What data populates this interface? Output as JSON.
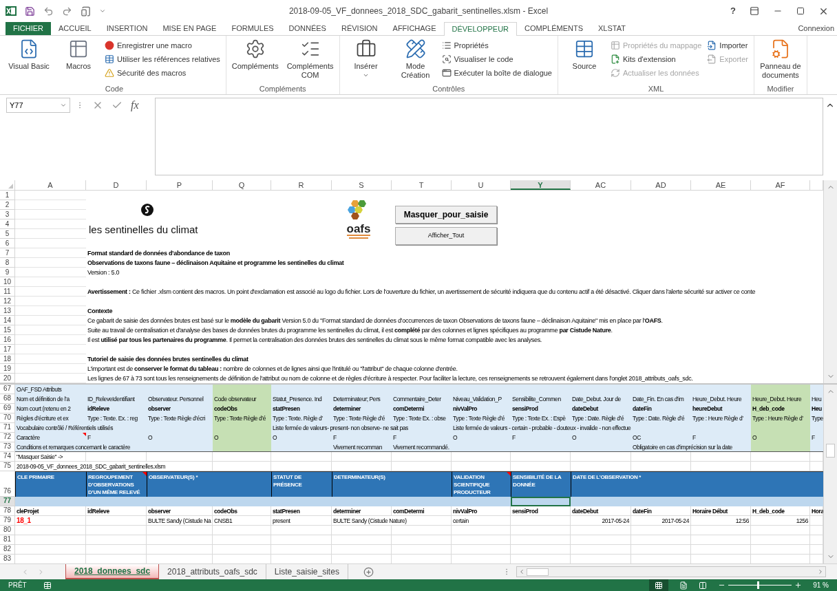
{
  "window": {
    "title": "2018-09-05_VF_donnees_2018_SDC_gabarit_sentinelles.xlsm - Excel",
    "help": "?",
    "account": "Connexion"
  },
  "ribbon_tabs": [
    {
      "label": "FICHIER",
      "kind": "file",
      "selected": false
    },
    {
      "label": "ACCUEIL",
      "kind": "tab",
      "selected": false
    },
    {
      "label": "INSERTION",
      "kind": "tab",
      "selected": false
    },
    {
      "label": "MISE EN PAGE",
      "kind": "tab",
      "selected": false
    },
    {
      "label": "FORMULES",
      "kind": "tab",
      "selected": false
    },
    {
      "label": "DONNÉES",
      "kind": "tab",
      "selected": false
    },
    {
      "label": "RÉVISION",
      "kind": "tab",
      "selected": false
    },
    {
      "label": "AFFICHAGE",
      "kind": "tab",
      "selected": false
    },
    {
      "label": "DÉVELOPPEUR",
      "kind": "tab",
      "selected": true
    },
    {
      "label": "COMPLÉMENTS",
      "kind": "tab",
      "selected": false
    },
    {
      "label": "XLSTAT",
      "kind": "tab",
      "selected": false
    }
  ],
  "ribbon_groups": [
    {
      "label": "Code",
      "items": [
        {
          "label": "Visual Basic",
          "kind": "large",
          "disabled": false,
          "menu": false
        },
        {
          "label": "Macros",
          "kind": "large",
          "disabled": false,
          "menu": false
        },
        {
          "label": "Enregistrer une macro",
          "kind": "small",
          "disabled": false,
          "menu": false
        },
        {
          "label": "Utiliser les références relatives",
          "kind": "small",
          "disabled": false,
          "menu": false
        },
        {
          "label": "Sécurité des macros",
          "kind": "small",
          "disabled": false,
          "menu": false
        }
      ]
    },
    {
      "label": "Compléments",
      "items": [
        {
          "label": "Compléments",
          "kind": "large",
          "disabled": false,
          "menu": false
        },
        {
          "label": "Compléments COM",
          "kind": "large",
          "disabled": false,
          "menu": false
        }
      ]
    },
    {
      "label": "Contrôles",
      "items": [
        {
          "label": "Insérer",
          "kind": "large",
          "disabled": false,
          "menu": true
        },
        {
          "label": "Mode Création",
          "kind": "large",
          "disabled": false,
          "menu": false
        },
        {
          "label": "Propriétés",
          "kind": "small",
          "disabled": false,
          "menu": false
        },
        {
          "label": "Visualiser le code",
          "kind": "small",
          "disabled": false,
          "menu": false
        },
        {
          "label": "Exécuter la boîte de dialogue",
          "kind": "small",
          "disabled": false,
          "menu": false
        }
      ]
    },
    {
      "label": "XML",
      "items": [
        {
          "label": "Source",
          "kind": "large",
          "disabled": false,
          "menu": false
        },
        {
          "label": "Propriétés du mappage",
          "kind": "small",
          "disabled": true,
          "menu": false
        },
        {
          "label": "Kits d'extension",
          "kind": "small",
          "disabled": false,
          "menu": false
        },
        {
          "label": "Actualiser les données",
          "kind": "small",
          "disabled": true,
          "menu": false
        },
        {
          "label": "Importer",
          "kind": "small",
          "disabled": false,
          "menu": false
        },
        {
          "label": "Exporter",
          "kind": "small",
          "disabled": true,
          "menu": false
        }
      ]
    },
    {
      "label": "Modifier",
      "items": [
        {
          "label": "Panneau de documents",
          "kind": "large",
          "disabled": false,
          "menu": false
        }
      ]
    }
  ],
  "formula_bar": {
    "name_box": "Y77",
    "function_button": "fx"
  },
  "columns": [
    {
      "label": "A",
      "selected": false,
      "highlighted": false
    },
    {
      "label": "D",
      "selected": false,
      "highlighted": false
    },
    {
      "label": "P",
      "selected": false,
      "highlighted": false
    },
    {
      "label": "Q",
      "selected": false,
      "highlighted": true
    },
    {
      "label": "R",
      "selected": false,
      "highlighted": false
    },
    {
      "label": "S",
      "selected": false,
      "highlighted": false
    },
    {
      "label": "T",
      "selected": false,
      "highlighted": false
    },
    {
      "label": "U",
      "selected": false,
      "highlighted": false
    },
    {
      "label": "Y",
      "selected": true,
      "highlighted": false
    },
    {
      "label": "AC",
      "selected": false,
      "highlighted": false
    },
    {
      "label": "AD",
      "selected": false,
      "highlighted": false
    },
    {
      "label": "AE",
      "selected": false,
      "highlighted": false
    },
    {
      "label": "AF",
      "selected": false,
      "highlighted": true
    },
    {
      "selected": false,
      "highlighted": false
    }
  ],
  "logos": {
    "sentinelles": "les sentinelles du climat",
    "oafs": "oafs"
  },
  "sheet_buttons": [
    "Masquer_pour_saisie",
    "Afficher_Tout"
  ],
  "top_rows": [
    {
      "number": "1",
      "kind": "blank"
    },
    {
      "number": "2",
      "kind": "blank"
    },
    {
      "number": "3",
      "kind": "blank"
    },
    {
      "number": "4",
      "kind": "blank"
    },
    {
      "number": "5",
      "kind": "blank"
    },
    {
      "number": "6",
      "kind": "blank"
    },
    {
      "number": "7",
      "kind": "heading",
      "text": "Format standard de données d’abondance de taxon"
    },
    {
      "number": "8",
      "kind": "heading",
      "text": "Observations de taxons faune – déclinaison Aquitaine et programme les sentinelles du climat"
    },
    {
      "number": "9",
      "kind": "text",
      "text": "Version : 5.0"
    },
    {
      "number": "10",
      "kind": "blank"
    },
    {
      "number": "11",
      "kind": "text",
      "text": "**Avertissement :** Ce fichier .xlsm contient des macros. Un point d'exclamation est associé au logo du fichier. Lors de l'ouverture du fichier, un avertissement de sécurité indiquera que du contenu actif a été désactivé. Cliquer dans l'alerte sécurité sur activer ce conte"
    },
    {
      "number": "12",
      "kind": "blank"
    },
    {
      "number": "13",
      "kind": "heading",
      "text": "Contexte"
    },
    {
      "number": "14",
      "kind": "text",
      "text": "Ce gabarit de saisie des données brutes est basé sur le **modèle du gabarit** Version 5.0 du \"Format standard de données d’occurrences de taxon Observations de taxons faune – déclinaison Aquitaine\" mis en place par l'**OAFS**."
    },
    {
      "number": "15",
      "kind": "text",
      "text": "Suite au travail de centralisation et d'analyse des bases de données brutes du programme les sentinelles du climat, il est **complété** par des colonnes et lignes spécifiques au programme **par Cistude Nature**."
    },
    {
      "number": "16",
      "kind": "text",
      "text": "Il est **utilisé par tous les partenaires du programme**. Il permet la centralisation des données brutes des sentinelles du climat sous le même format compatible avec les analyses."
    },
    {
      "number": "17",
      "kind": "blank"
    },
    {
      "number": "18",
      "kind": "heading",
      "text": "Tutoriel de saisie des données brutes sentinelles du climat"
    },
    {
      "number": "19",
      "kind": "text",
      "text": "L'important est de **conserver le format du tableau :** nombre de colonnes et de lignes ainsi que l'intitulé ou \"l'attribut\" de chaque colonne d'entrée."
    },
    {
      "number": "20",
      "kind": "text",
      "text": "Les lignes de 67 à 73 sont tous les renseignements de définition de l'attribut ou nom de colonne et de règles d'écriture à respecter. Pour faciliter la lecture, ces renseignements se retrouvent également dans l'onglet 2018_attributs_oafs_sdc."
    }
  ],
  "bottom_rows": [
    {
      "number": "67",
      "kind": "attribute",
      "selected": false,
      "cells": [
        "OAF_FSD Attributs",
        null,
        null,
        null,
        null,
        null,
        null,
        null,
        null,
        null,
        null,
        null,
        null,
        null
      ]
    },
    {
      "number": "68",
      "kind": "attribute",
      "selected": false,
      "cells": [
        "Nom et définition de l’a",
        "ID_ReleveIdentifiant",
        "Observateur. Personnel",
        "Code observateur",
        "Statut_Presence. Ind",
        "Determinateur; Pers",
        "Commentaire_Deter",
        "Niveau_Validation_P",
        "Sensibilite_Commen",
        "Date_Debut. Jour de",
        "Date_Fin. En cas d'im",
        "Heure_Debut. Heure",
        "Heure_Debut. Heure",
        "Heu"
      ]
    },
    {
      "number": "69",
      "kind": "short_names",
      "selected": false,
      "cells": [
        "Nom court (retenu en 2",
        "idReleve",
        "observer",
        "codeObs",
        "statPresen",
        "determiner",
        "comDetermi",
        "nivValPro",
        "sensiProd",
        "dateDebut",
        "dateFin",
        "heureDebut",
        "H_deb_code",
        "Heu"
      ]
    },
    {
      "number": "70",
      "kind": "attribute",
      "selected": false,
      "cells": [
        "Règles d’écriture et ex",
        "Type : Texte. Ex. : reg",
        "Type : Texte Règle d’écri",
        "Type : Texte Règle d’é",
        "Type : Texte. Règle d’",
        "Type : Texte Règle d’é",
        "Type : Texte Ex. : obse",
        "Type : Texte Règle d’é",
        "Type : Texte Ex. : Espè",
        "Type : Date. Règle d’é",
        "Type : Date. Règle d’é",
        "Type : Heure Règle d’",
        "Type : Heure Règle d’",
        "Type"
      ]
    },
    {
      "number": "71",
      "kind": "attribute",
      "selected": false,
      "cells": [
        "Vocabulaire contrôlé / Référentiels utilisés",
        null,
        null,
        null,
        "Liste fermée de valeurs- present- non observe- ne sait pas",
        null,
        null,
        "Liste fermée de valeurs - certain - probable - douteux - invalide - non effectue",
        null,
        null,
        null,
        null,
        null,
        null
      ]
    },
    {
      "number": "72",
      "kind": "attribute",
      "selected": false,
      "cells": [
        {
          "text": "Caractère",
          "comment": true
        },
        "F",
        "O",
        "O",
        "O",
        "F",
        "F",
        "O",
        "F",
        "O",
        "OC",
        "F",
        "O",
        "F"
      ]
    },
    {
      "number": "73",
      "kind": "attribute",
      "selected": false,
      "cells": [
        "Conditions et remarques concernant le caractère",
        null,
        null,
        null,
        null,
        "Vivement recomman",
        "Vivement recommandé.",
        null,
        null,
        null,
        "Obligatoire en cas d’imprécision sur la date",
        null,
        null,
        null
      ]
    },
    {
      "number": "74",
      "kind": "plain",
      "selected": false,
      "cells": [
        "\"Masquer Saisie\" ->",
        null,
        null,
        null,
        null,
        null,
        null,
        null,
        null,
        null,
        null,
        null,
        null,
        null
      ]
    },
    {
      "number": "75",
      "kind": "plain",
      "selected": false,
      "cells": [
        "2018-09-05_VF_donnees_2018_SDC_gabarit_sentinelles.xlsm",
        null,
        null,
        null,
        null,
        null,
        null,
        null,
        null,
        null,
        null,
        null,
        null,
        null
      ]
    },
    {
      "number": "76",
      "kind": "header",
      "selected": false,
      "cells": [
        "CLE PRIMAIRE",
        {
          "text": "REGROUPEMENT D’OBSERVATIONS D’UN MÊME RELEVÉ",
          "comment": true
        },
        "OBSERVATEUR(S) *",
        null,
        "STATUT DE PRÉSENCE",
        "DETERMINATEUR(S)",
        null,
        {
          "text": "VALIDATION SCIENTIFIQUE PRODUCTEUR",
          "comment": true
        },
        "SENSIBILITÉ DE LA DONNÉE",
        "DATE DE L’OBSERVATION *",
        null,
        null,
        null,
        null
      ]
    },
    {
      "number": "77",
      "kind": "band",
      "selected": true,
      "cells": [
        null,
        null,
        null,
        null,
        null,
        null,
        null,
        null,
        null,
        null,
        null,
        null,
        null,
        null
      ]
    },
    {
      "number": "78",
      "kind": "fields",
      "selected": false,
      "cells": [
        "cleProjet",
        "idReleve",
        "observer",
        "codeObs",
        "statPresen",
        "determiner",
        "comDetermi",
        "nivValPro",
        "sensiProd",
        "dateDebut",
        "dateFin",
        "Horaire Début",
        "H_deb_code",
        "Hora"
      ]
    },
    {
      "number": "79",
      "kind": "data",
      "selected": false,
      "cells": [
        {
          "text": "18_1",
          "color": "#ff0000"
        },
        null,
        "BULTE Sandy (Cistude Na",
        "CNSB1",
        "present",
        "BULTE Sandy (Cistude Nature)",
        null,
        "certain",
        null,
        {
          "text": "2017-05-24",
          "kind": "number"
        },
        {
          "text": "2017-05-24",
          "kind": "number"
        },
        {
          "text": "12:56",
          "kind": "number"
        },
        {
          "text": "1256",
          "kind": "number"
        },
        null
      ]
    },
    {
      "number": "80",
      "kind": "data",
      "selected": false,
      "cells": [
        null,
        null,
        null,
        null,
        null,
        null,
        null,
        null,
        null,
        null,
        null,
        null,
        null,
        null
      ]
    },
    {
      "number": "81",
      "kind": "data",
      "selected": false,
      "cells": [
        null,
        null,
        null,
        null,
        null,
        null,
        null,
        null,
        null,
        null,
        null,
        null,
        null,
        null
      ]
    },
    {
      "number": "82",
      "kind": "data",
      "selected": false,
      "cells": [
        null,
        null,
        null,
        null,
        null,
        null,
        null,
        null,
        null,
        null,
        null,
        null,
        null,
        null
      ]
    },
    {
      "number": "83",
      "kind": "data",
      "selected": false,
      "cells": [
        null,
        null,
        null,
        null,
        null,
        null,
        null,
        null,
        null,
        null,
        null,
        null,
        null,
        null
      ]
    }
  ],
  "sheet_tabs": [
    {
      "label": "2018_donnees_sdc",
      "selected": true
    },
    {
      "label": "2018_attributs_oafs_sdc",
      "selected": false
    },
    {
      "label": "Liste_saisie_sites",
      "selected": false
    }
  ],
  "status_bar": {
    "ready": "PRÊT",
    "zoom": "91 %",
    "zoom_slider": {
      "level": 0.47
    }
  }
}
